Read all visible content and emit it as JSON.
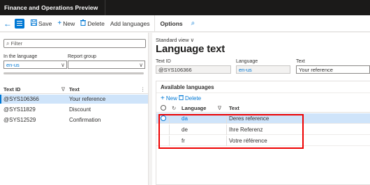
{
  "titlebar": {
    "app_name": "Finance and Operations Preview"
  },
  "actionbar": {
    "back_icon": "arrow-left-icon",
    "menu_icon": "hamburger-icon",
    "save_label": "Save",
    "new_label": "New",
    "delete_label": "Delete",
    "add_languages_label": "Add languages",
    "options_label": "Options"
  },
  "leftpane": {
    "filter_placeholder": "Filter",
    "in_language_label": "In the language",
    "in_language_value": "en-us",
    "report_group_label": "Report group",
    "report_group_value": "",
    "columns": {
      "text_id": "Text ID",
      "text": "Text"
    },
    "rows": [
      {
        "text_id": "@SYS106366",
        "text": "Your reference",
        "selected": true
      },
      {
        "text_id": "@SYS11829",
        "text": "Discount",
        "selected": false
      },
      {
        "text_id": "@SYS12529",
        "text": "Confirmation",
        "selected": false
      }
    ]
  },
  "main": {
    "view_label": "Standard view",
    "title": "Language text",
    "text_id_label": "Text ID",
    "text_id_value": "@SYS106366",
    "language_label": "Language",
    "language_value": "en-us",
    "text_label": "Text",
    "text_value": "Your reference"
  },
  "available": {
    "title": "Available languages",
    "new_label": "New",
    "delete_label": "Delete",
    "columns": {
      "language": "Language",
      "text": "Text"
    },
    "rows": [
      {
        "language": "da",
        "text": "Deres reference",
        "selected": true
      },
      {
        "language": "de",
        "text": "Ihre Referenz",
        "selected": false
      },
      {
        "language": "fr",
        "text": "Votre référence",
        "selected": false
      }
    ]
  },
  "colors": {
    "accent": "#0078d4",
    "titlebar": "#1b1a19",
    "highlight": "#ee0000",
    "selected_row": "#cfe4fa"
  }
}
